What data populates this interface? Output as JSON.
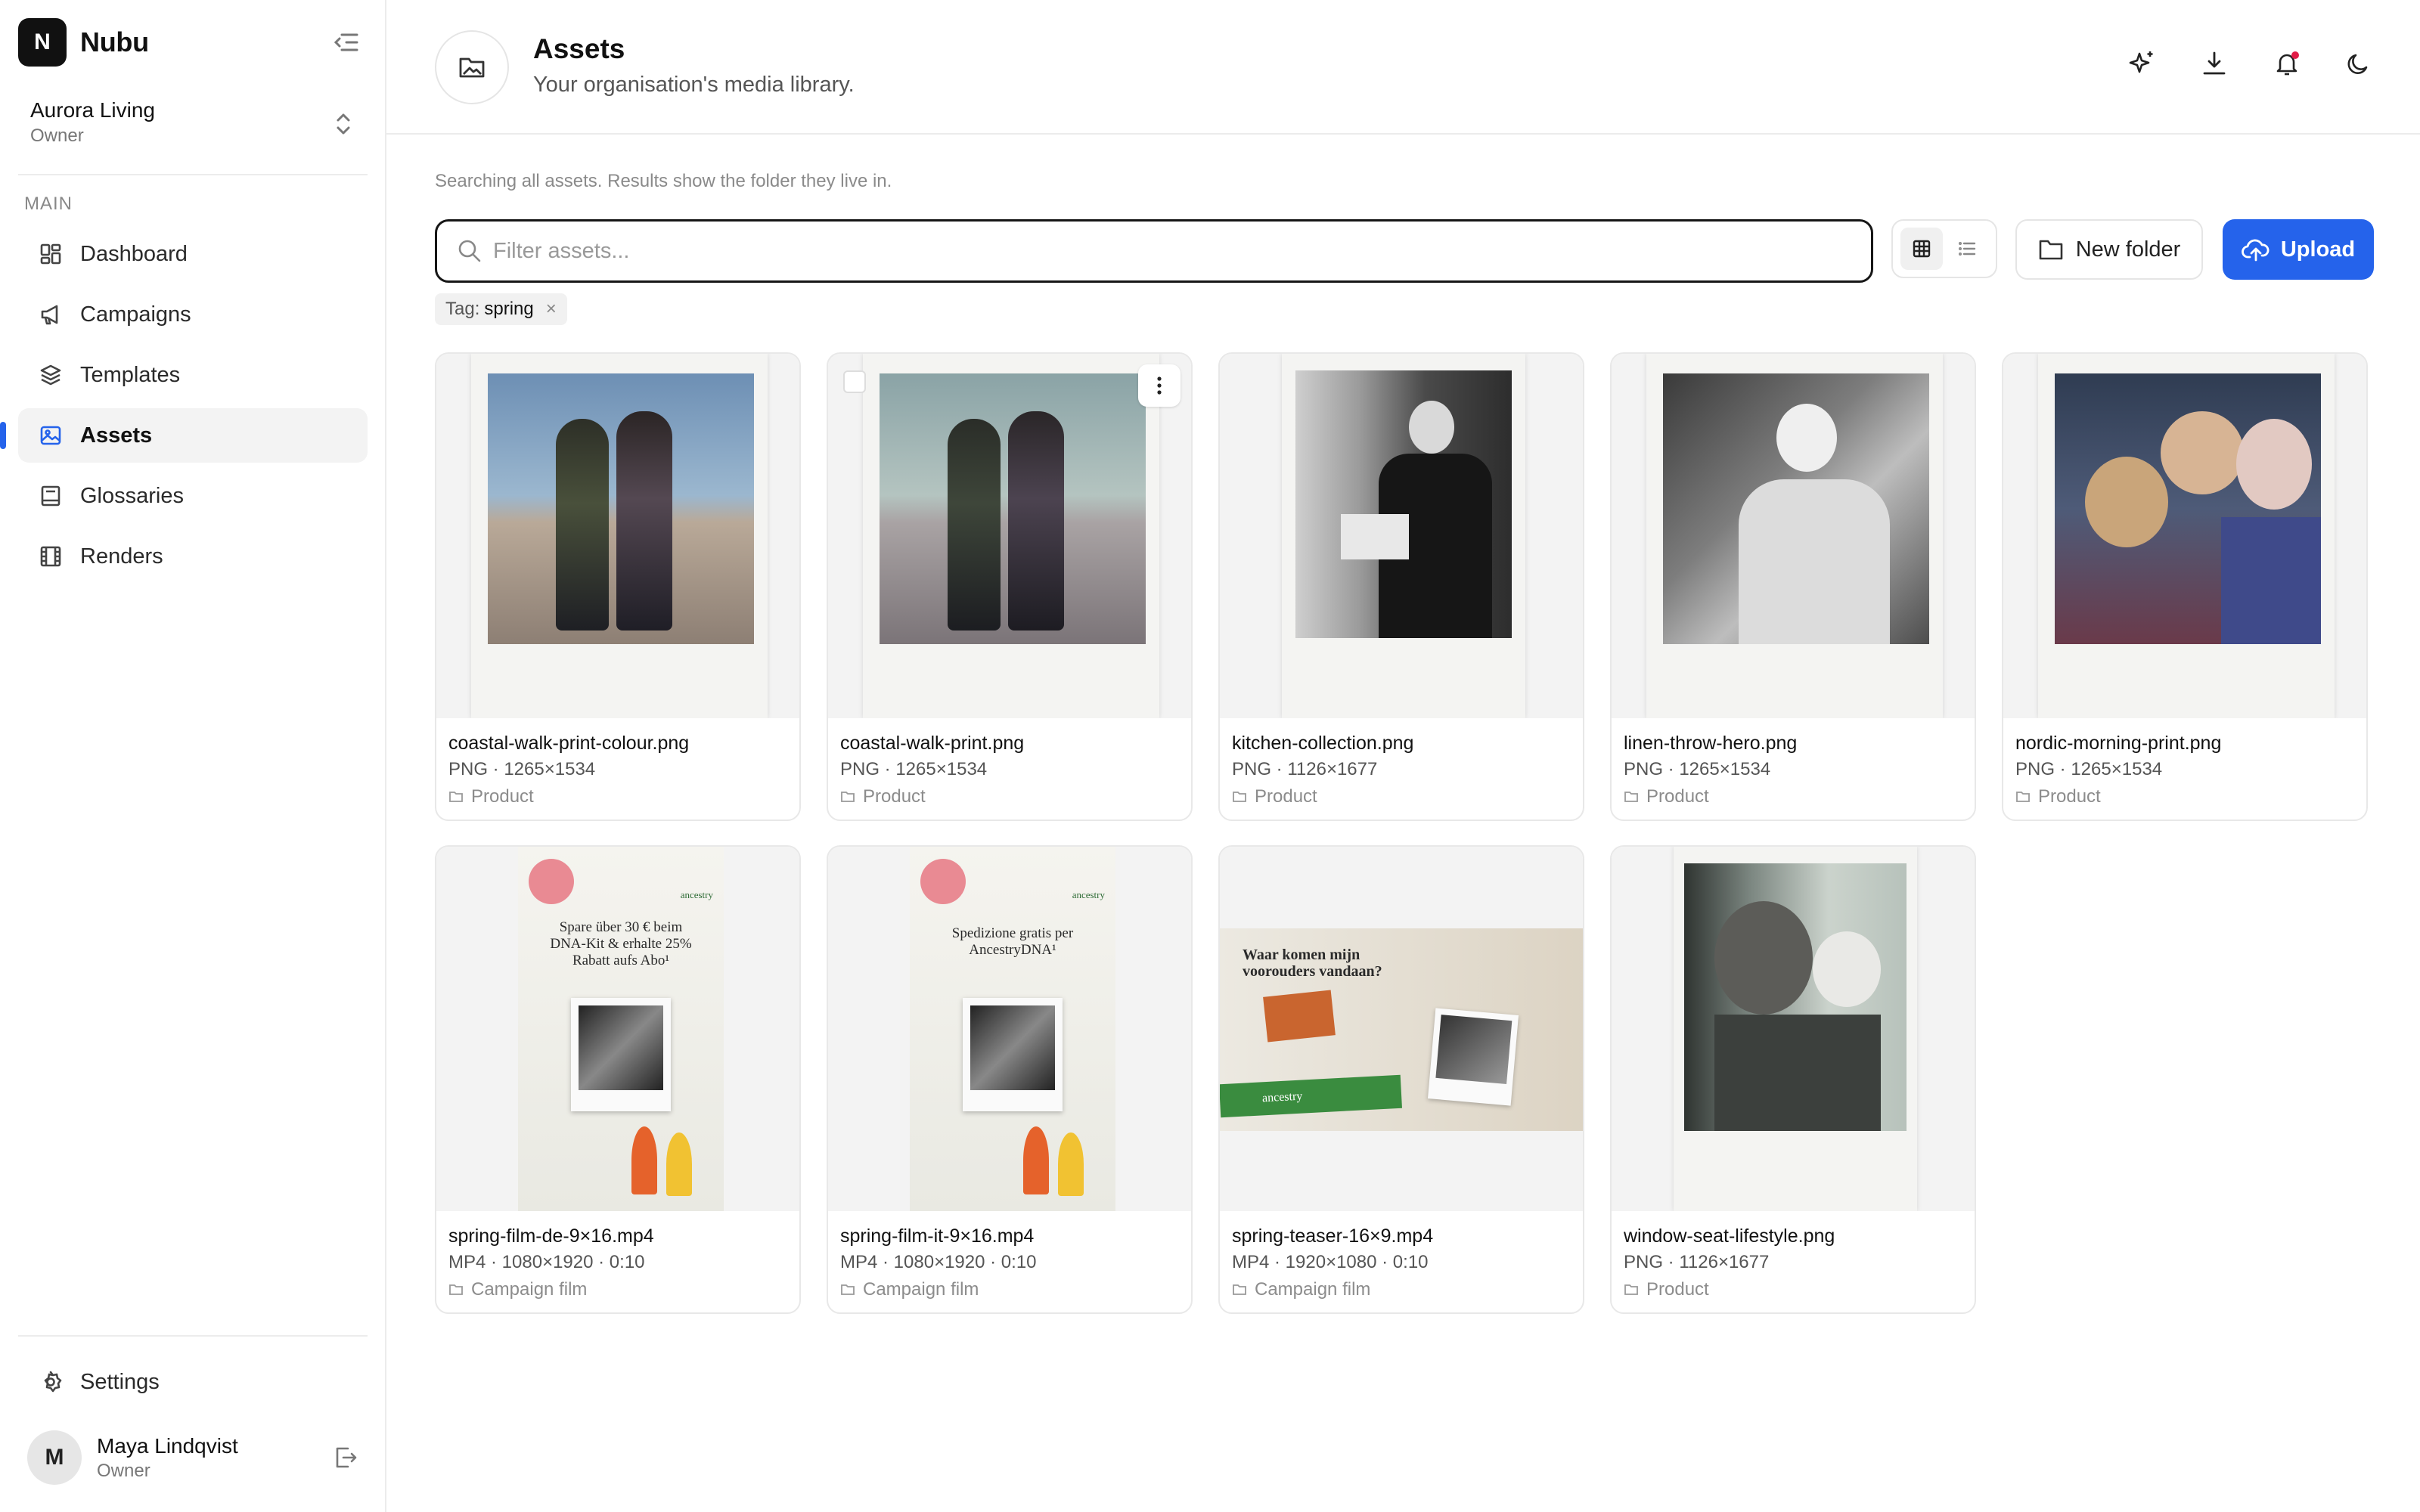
{
  "app": {
    "name": "Nubu",
    "logo_letter": "N"
  },
  "workspace": {
    "name": "Aurora Living",
    "role": "Owner"
  },
  "sidebar": {
    "section_label": "MAIN",
    "items": [
      {
        "label": "Dashboard",
        "icon": "dashboard-icon"
      },
      {
        "label": "Campaigns",
        "icon": "megaphone-icon"
      },
      {
        "label": "Templates",
        "icon": "layers-icon"
      },
      {
        "label": "Assets",
        "icon": "image-icon",
        "active": true
      },
      {
        "label": "Glossaries",
        "icon": "book-icon"
      },
      {
        "label": "Renders",
        "icon": "film-icon"
      }
    ],
    "settings_label": "Settings"
  },
  "user": {
    "initial": "M",
    "name": "Maya Lindqvist",
    "role": "Owner"
  },
  "header": {
    "title": "Assets",
    "subtitle": "Your organisation's media library."
  },
  "toolbar": {
    "hint": "Searching all assets. Results show the folder they live in.",
    "search_placeholder": "Filter assets...",
    "search_value": "",
    "view_mode": "grid",
    "new_folder_label": "New folder",
    "upload_label": "Upload"
  },
  "filter_tag": {
    "prefix": "Tag:",
    "value": "spring"
  },
  "colors": {
    "accent": "#2563eb",
    "notification": "#e11d48"
  },
  "assets": [
    {
      "name": "coastal-walk-print-colour.png",
      "detail": "PNG · 1265×1534",
      "folder": "Product"
    },
    {
      "name": "coastal-walk-print.png",
      "detail": "PNG · 1265×1534",
      "folder": "Product"
    },
    {
      "name": "kitchen-collection.png",
      "detail": "PNG · 1126×1677",
      "folder": "Product"
    },
    {
      "name": "linen-throw-hero.png",
      "detail": "PNG · 1265×1534",
      "folder": "Product"
    },
    {
      "name": "nordic-morning-print.png",
      "detail": "PNG · 1265×1534",
      "folder": "Product"
    },
    {
      "name": "spring-film-de-9×16.mp4",
      "detail": "MP4 · 1080×1920 · 0:10",
      "folder": "Campaign film"
    },
    {
      "name": "spring-film-it-9×16.mp4",
      "detail": "MP4 · 1080×1920 · 0:10",
      "folder": "Campaign film"
    },
    {
      "name": "spring-teaser-16×9.mp4",
      "detail": "MP4 · 1920×1080 · 0:10",
      "folder": "Campaign film"
    },
    {
      "name": "window-seat-lifestyle.png",
      "detail": "PNG · 1126×1677",
      "folder": "Product"
    }
  ],
  "promo_text": {
    "de": "Spare über 30 € beim DNA-Kit & erhalte 25% Rabatt aufs Abo¹",
    "it": "Spedizione gratis per AncestryDNA¹",
    "teaser": "Waar komen mijn voorouders vandaan?",
    "teaser_ribbon": "ancestry",
    "brand": "ancestry"
  }
}
